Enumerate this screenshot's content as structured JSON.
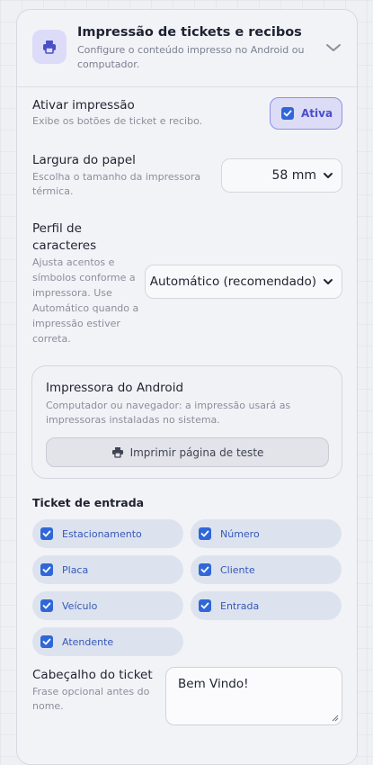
{
  "header": {
    "title": "Impressão de tickets e recibos",
    "subtitle": "Configure o conteúdo impresso no Android ou computador.",
    "icon": "printer-icon"
  },
  "enable_print": {
    "title": "Ativar impressão",
    "description": "Exibe os botões de ticket e recibo.",
    "toggle_label": "Ativa",
    "checked": true
  },
  "paper_width": {
    "title": "Largura do papel",
    "description": "Escolha o tamanho da impressora térmica.",
    "selected": "58 mm"
  },
  "char_profile": {
    "title": "Perfil de caracteres",
    "description": "Ajusta acentos e símbolos conforme a impressora. Use Automático quando a impressão estiver correta.",
    "selected": "Automático (recomendado)"
  },
  "android_printer": {
    "title": "Impressora do Android",
    "description": "Computador ou navegador: a impressão usará as impressoras instaladas no sistema.",
    "test_button": "Imprimir página de teste"
  },
  "entry_ticket": {
    "title": "Ticket de entrada",
    "options": [
      {
        "label": "Estacionamento",
        "checked": true
      },
      {
        "label": "Número",
        "checked": true
      },
      {
        "label": "Placa",
        "checked": true
      },
      {
        "label": "Cliente",
        "checked": true
      },
      {
        "label": "Veículo",
        "checked": true
      },
      {
        "label": "Entrada",
        "checked": true
      },
      {
        "label": "Atendente",
        "checked": true
      }
    ]
  },
  "ticket_header": {
    "title": "Cabeçalho do ticket",
    "description": "Frase opcional antes do nome.",
    "value": "Bem Vindo!"
  },
  "colors": {
    "accent": "#4a4fc9",
    "checkbox": "#2f67d8",
    "chip_bg": "#dde3ee"
  }
}
